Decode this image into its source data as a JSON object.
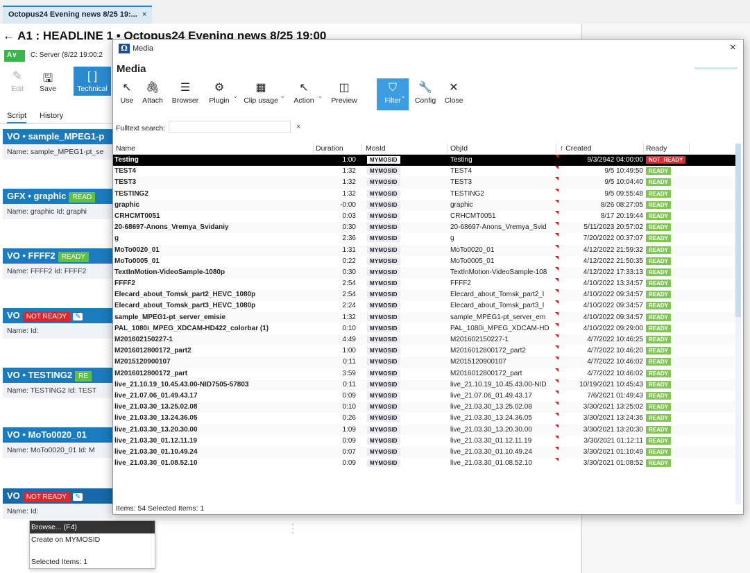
{
  "app": {
    "doc_tab": "Octopus24 Evening news 8/25 19:...",
    "doc_tab_close": "×",
    "headline": "← A1 : HEADLINE 1 • Octopus24 Evening news 8/25 19:00",
    "version_badge": "A∨",
    "server_info": "C: Server (8/22 19:00:2",
    "tools": [
      {
        "label": "Edit",
        "icon": "✎"
      },
      {
        "label": "Save",
        "icon": "🖫"
      },
      {
        "label": "Technical",
        "icon": "[ ]"
      }
    ],
    "subtabs": [
      "Script",
      "History"
    ],
    "stories": [
      {
        "title": "VO • sample_MPEG1-p",
        "name": "Name:  sample_MPEG1-pt_se"
      },
      {
        "title": "GFX • graphic",
        "badge": "READ",
        "name": "Name:  graphic     Id:  graphi"
      },
      {
        "title": "VO • FFFF2",
        "badge": "READY",
        "name": "Name:  FFFF2     Id:  FFFF2"
      },
      {
        "title": "VO",
        "badge": "NOT READY",
        "name": "Name:               Id:"
      },
      {
        "title": "VO • TESTING2",
        "badge": "RE",
        "name": "Name:  TESTING2   Id:  TEST"
      },
      {
        "title": "VO • MoTo0020_01",
        "name": "Name:  MoTo0020_01   Id:  M"
      },
      {
        "title": "VO",
        "badge": "NOT READY",
        "name": "Name:               Id:"
      }
    ],
    "dropdown": {
      "items": [
        "Browse... (F4)",
        "Create on MYMOSID"
      ],
      "footer": "Selected Items: 1"
    }
  },
  "dialog": {
    "window_title": "Media",
    "heading": "Media",
    "close": "×",
    "toolbar": [
      {
        "label": "Use",
        "icon": "↖"
      },
      {
        "label": "Attach",
        "icon": "🖇"
      },
      {
        "label": "Browser",
        "icon": "☰"
      },
      {
        "label": "Plugin",
        "icon": "⚙"
      },
      {
        "label": "Clip usage",
        "icon": "▦"
      },
      {
        "label": "Action",
        "icon": "↖"
      },
      {
        "label": "Preview",
        "icon": "◫"
      },
      {
        "label": "Filter",
        "icon": "⛉"
      },
      {
        "label": "Config",
        "icon": "🔧"
      },
      {
        "label": "Close",
        "icon": "✕"
      }
    ],
    "search": {
      "label": "Fulltext search:",
      "value": "",
      "clear": "×"
    },
    "columns": [
      "Name",
      "Duration",
      "MosId",
      "ObjId",
      "↑ Created",
      "Ready"
    ],
    "rows": [
      [
        "Testing",
        "1:00",
        "MYMOSID",
        "Testing",
        "9/3/2942 04:00:00",
        "NOT_READY"
      ],
      [
        "TEST4",
        "1:32",
        "MYMOSID",
        "TEST4",
        "9/5 10:49:50",
        "READY"
      ],
      [
        "TEST3",
        "1:32",
        "MYMOSID",
        "TEST3",
        "9/5 10:04:40",
        "READY"
      ],
      [
        "TESTING2",
        "1:32",
        "MYMOSID",
        "TESTING2",
        "9/5 09:55:48",
        "READY"
      ],
      [
        "graphic",
        "-0:00",
        "MYMOSID",
        "graphic",
        "8/26 08:27:05",
        "READY"
      ],
      [
        "CRHCMT0051",
        "0:03",
        "MYMOSID",
        "CRHCMT0051",
        "8/17 20:19:44",
        "READY"
      ],
      [
        "20-68697-Anons_Vremya_Svidaniy",
        "0:30",
        "MYMOSID",
        "20-68697-Anons_Vremya_Svid",
        "5/11/2023 20:57:02",
        "READY"
      ],
      [
        "g",
        "2:36",
        "MYMOSID",
        "g",
        "7/20/2022 00:37:07",
        "READY"
      ],
      [
        "MoTo0020_01",
        "1:31",
        "MYMOSID",
        "MoTo0020_01",
        "4/12/2022 21:59:32",
        "READY"
      ],
      [
        "MoTo0005_01",
        "0:22",
        "MYMOSID",
        "MoTo0005_01",
        "4/12/2022 21:50:35",
        "READY"
      ],
      [
        "TextInMotion-VideoSample-1080p",
        "0:30",
        "MYMOSID",
        "TextInMotion-VideoSample-108",
        "4/12/2022 17:33:13",
        "READY"
      ],
      [
        "FFFF2",
        "2:54",
        "MYMOSID",
        "FFFF2",
        "4/10/2022 13:34:57",
        "READY"
      ],
      [
        "Elecard_about_Tomsk_part2_HEVC_1080p",
        "2:54",
        "MYMOSID",
        "Elecard_about_Tomsk_part2_l",
        "4/10/2022 09:34:57",
        "READY"
      ],
      [
        "Elecard_about_Tomsk_part3_HEVC_1080p",
        "2:24",
        "MYMOSID",
        "Elecard_about_Tomsk_part3_l",
        "4/10/2022 09:34:57",
        "READY"
      ],
      [
        "sample_MPEG1-pt_server_emisie",
        "1:32",
        "MYMOSID",
        "sample_MPEG1-pt_server_em",
        "4/10/2022 09:34:57",
        "READY"
      ],
      [
        "PAL_1080i_MPEG_XDCAM-HD422_colorbar (1)",
        "0:10",
        "MYMOSID",
        "PAL_1080i_MPEG_XDCAM-HD",
        "4/10/2022 09:29:00",
        "READY"
      ],
      [
        "M201602150227-1",
        "4:49",
        "MYMOSID",
        "M201602150227-1",
        "4/7/2022 10:46:25",
        "READY"
      ],
      [
        "M2016012800172_part2",
        "1:00",
        "MYMOSID",
        "M2016012800172_part2",
        "4/7/2022 10:46:20",
        "READY"
      ],
      [
        "M2015120900107",
        "0:11",
        "MYMOSID",
        "M2015120900107",
        "4/7/2022 10:46:02",
        "READY"
      ],
      [
        "M2016012800172_part",
        "3:59",
        "MYMOSID",
        "M2016012800172_part",
        "4/7/2022 10:46:02",
        "READY"
      ],
      [
        "live_21.10.19_10.45.43.00-NID7505-57803",
        "0:11",
        "MYMOSID",
        "live_21.10.19_10.45.43.00-NID",
        "10/19/2021 10:45:43",
        "READY"
      ],
      [
        "live_21.07.06_01.49.43.17",
        "0:09",
        "MYMOSID",
        "live_21.07.06_01.49.43.17",
        "7/6/2021 01:49:43",
        "READY"
      ],
      [
        "live_21.03.30_13.25.02.08",
        "0:10",
        "MYMOSID",
        "live_21.03.30_13.25.02.08",
        "3/30/2021 13:25:02",
        "READY"
      ],
      [
        "live_21.03.30_13.24.36.05",
        "0:26",
        "MYMOSID",
        "live_21.03.30_13.24.36.05",
        "3/30/2021 13:24:36",
        "READY"
      ],
      [
        "live_21.03.30_13.20.30.00",
        "1:09",
        "MYMOSID",
        "live_21.03.30_13.20.30.00",
        "3/30/2021 13:20:30",
        "READY"
      ],
      [
        "live_21.03.30_01.12.11.19",
        "0:09",
        "MYMOSID",
        "live_21.03.30_01.12.11.19",
        "3/30/2021 01:12:11",
        "READY"
      ],
      [
        "live_21.03.30_01.10.49.24",
        "0:07",
        "MYMOSID",
        "live_21.03.30_01.10.49.24",
        "3/30/2021 01:10:49",
        "READY"
      ],
      [
        "live_21.03.30_01.08.52.10",
        "0:09",
        "MYMOSID",
        "live_21.03.30_01.08.52.10",
        "3/30/2021 01:08:52",
        "READY"
      ]
    ],
    "status": "Items: 54  Selected Items: 1"
  }
}
